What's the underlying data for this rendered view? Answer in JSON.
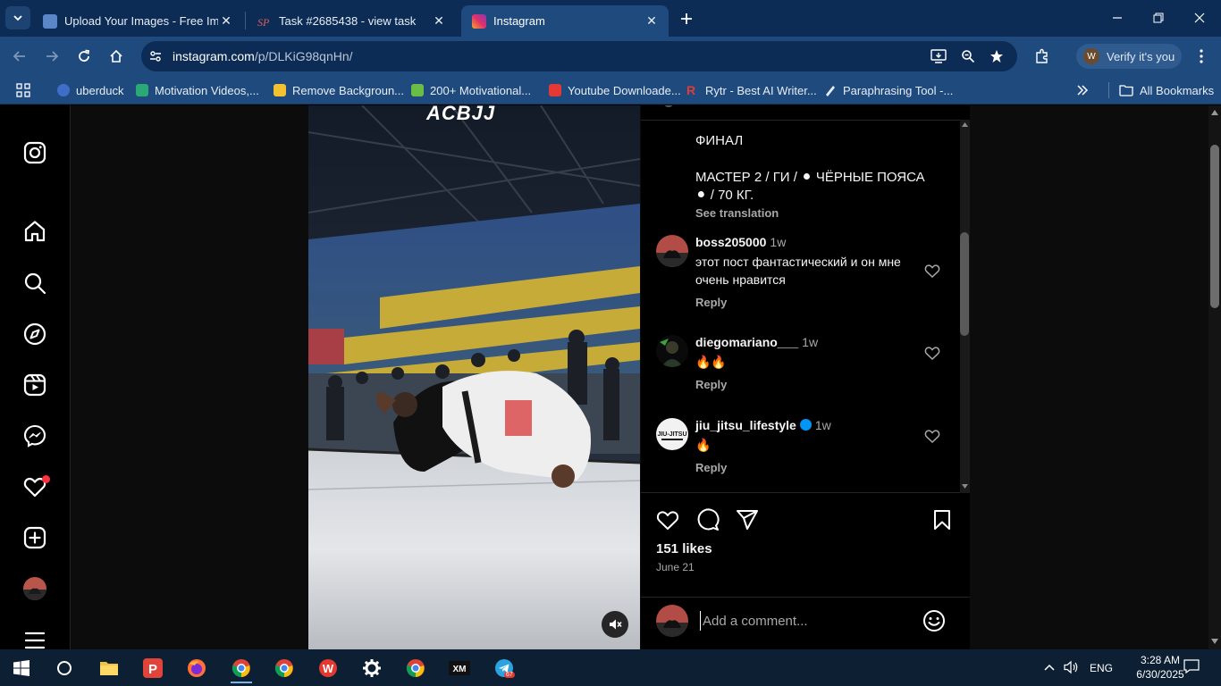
{
  "browser": {
    "tabs": [
      {
        "title": "Upload Your Images - Free Ima",
        "favicon": "image-upload-icon",
        "active": false
      },
      {
        "title": "Task #2685438 - view task",
        "favicon": "sp-task-icon",
        "active": false
      },
      {
        "title": "Instagram",
        "favicon": "instagram-icon",
        "active": true
      }
    ],
    "url_domain": "instagram.com",
    "url_path": "/p/DLKiG98qnHn/",
    "profile_label": "Verify it's you",
    "bookmarks": [
      {
        "label": "uberduck",
        "color": "#3f6ec9"
      },
      {
        "label": "Motivation Videos,...",
        "color": "#2aa876"
      },
      {
        "label": "Remove Backgroun...",
        "color": "#f2c230"
      },
      {
        "label": "200+ Motivational...",
        "color": "#6bbe45"
      },
      {
        "label": "Youtube Downloade...",
        "color": "#e53935"
      },
      {
        "label": "Rytr - Best AI Writer...",
        "color": "#e53935"
      },
      {
        "label": "Paraphrasing Tool -...",
        "color": "#e6edf7"
      }
    ],
    "all_bookmarks_label": "All Bookmarks"
  },
  "post": {
    "logo_text": "ACBJJ",
    "caption_lines": [
      "ФИНАЛ",
      "МАСТЕР 2 / ГИ / ⚫ ЧЁРНЫЕ ПОЯСА",
      "⚫ / 70 КГ."
    ],
    "see_translation": "See translation",
    "comments": [
      {
        "user": "boss205000",
        "time": "1w",
        "text": "этот пост фантастический и он мне очень нравится",
        "reply": "Reply",
        "verified": false
      },
      {
        "user": "diegomariano___",
        "time": "1w",
        "text": "🔥🔥",
        "reply": "Reply",
        "verified": false
      },
      {
        "user": "jiu_jitsu_lifestyle",
        "time": "1w",
        "text": "🔥",
        "reply": "Reply",
        "verified": true
      }
    ],
    "likes": "151 likes",
    "date": "June 21",
    "comment_placeholder": "Add a comment..."
  },
  "taskbar": {
    "language": "ENG",
    "time": "3:28 AM",
    "date": "6/30/2025",
    "telegram_badge": "67"
  },
  "colors": {
    "chrome_dark": "#0c2c55",
    "chrome_light": "#1e4a7e",
    "ig_bg": "#000000",
    "ig_secondary_text": "#a8a8a8",
    "notification_dot": "#ff3040",
    "verified_blue": "#0095f6"
  }
}
